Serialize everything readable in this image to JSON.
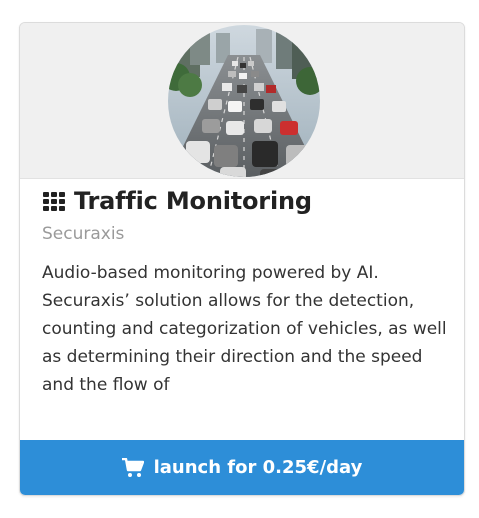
{
  "card": {
    "image_alt": "Traffic congestion on a multi-lane road",
    "title": "Traffic Monitoring",
    "vendor": "Securaxis",
    "description": "Audio-based monitoring powered by AI. Securaxis’ solution allows for the detection, counting and categorization of vehicles, as well as determining their direction and the speed and the flow of",
    "title_icon": "grid-icon",
    "launch_icon": "cart-icon",
    "launch_label": "launch for 0.25€/day"
  },
  "colors": {
    "accent": "#2d8ed8",
    "title": "#222222",
    "vendor": "#9a9a9a",
    "text": "#333333",
    "hero_bg": "#f0f0f0"
  }
}
